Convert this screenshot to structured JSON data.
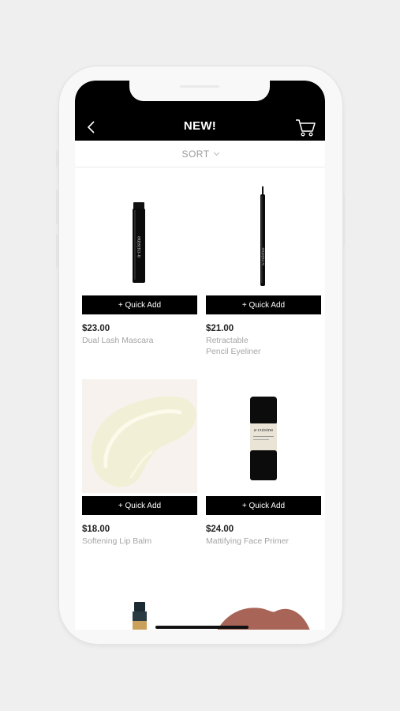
{
  "header": {
    "title": "NEW!",
    "back_icon": "chevron-left-icon",
    "cart_icon": "cart-icon",
    "background": "#000000"
  },
  "sort": {
    "label": "SORT",
    "icon": "chevron-down-icon"
  },
  "products": [
    {
      "price": "$23.00",
      "name": "Dual Lash Mascara",
      "button": "+ Quick Add",
      "image": "mascara"
    },
    {
      "price": "$21.00",
      "name": "Retractable Pencil Eyeliner",
      "button": "+ Quick Add",
      "image": "eyeliner"
    },
    {
      "price": "$18.00",
      "name": "Softening Lip Balm",
      "button": "+ Quick Add",
      "image": "lip-balm-swatch"
    },
    {
      "price": "$24.00",
      "name": "Mattifying Face Primer",
      "button": "+ Quick Add",
      "image": "face-primer"
    }
  ],
  "colors": {
    "button_bg": "#000000",
    "button_text": "#ffffff",
    "name_text": "#a5a5a5",
    "price_text": "#222222"
  }
}
